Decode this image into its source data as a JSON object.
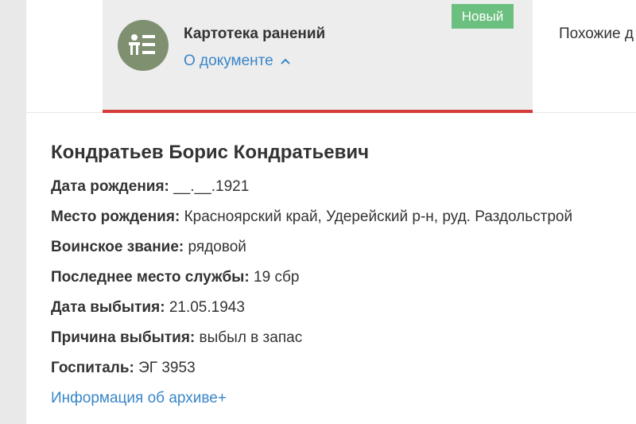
{
  "tabs": {
    "document": {
      "title": "Картотека ранений",
      "about_label": "О документе",
      "badge": "Новый"
    },
    "similar_label": "Похожие д"
  },
  "person": {
    "name": "Кондратьев Борис Кондратьевич",
    "fields": [
      {
        "label": "Дата рождения:",
        "value": "__.__.1921"
      },
      {
        "label": "Место рождения:",
        "value": "Красноярский край, Удерейский р-н, руд. Раздольстрой"
      },
      {
        "label": "Воинское звание:",
        "value": "рядовой"
      },
      {
        "label": "Последнее место службы:",
        "value": "19 сбр"
      },
      {
        "label": "Дата выбытия:",
        "value": "21.05.1943"
      },
      {
        "label": "Причина выбытия:",
        "value": "выбыл в запас"
      },
      {
        "label": "Госпиталь:",
        "value": "ЭГ 3953"
      }
    ],
    "archive_link": "Информация об архиве+"
  },
  "colors": {
    "accent_red": "#d53b3a",
    "badge_green": "#6cc07f",
    "link_blue": "#3a86c8",
    "avatar_green": "#7f9070"
  },
  "icons": {
    "avatar": "person-card-icon",
    "about_toggle": "chevron-up-icon"
  }
}
